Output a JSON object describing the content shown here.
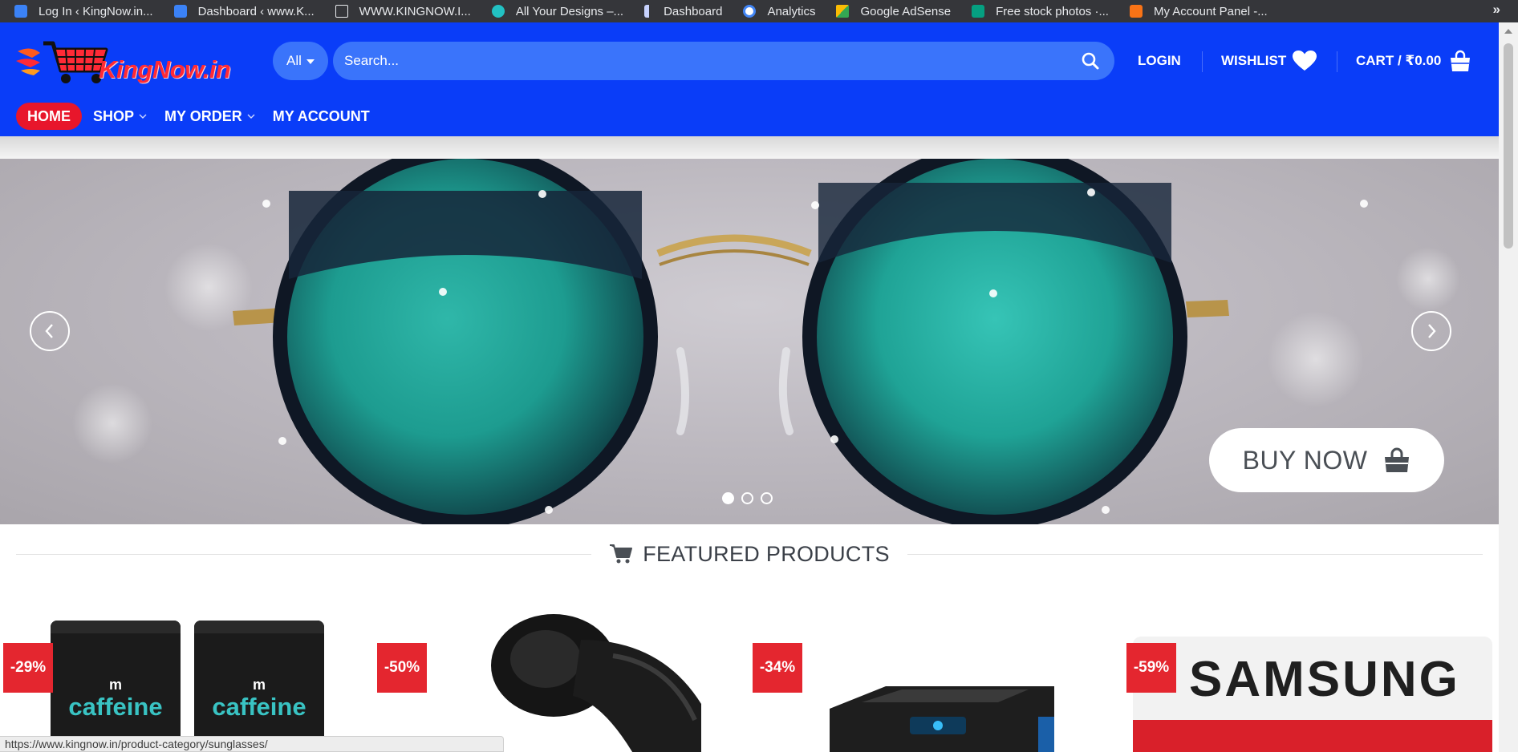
{
  "bookmarks": {
    "items": [
      {
        "label": "Log In ‹ KingNow.in...",
        "icon": "wordpress-icon",
        "color": "#3b82f6"
      },
      {
        "label": "Dashboard ‹ www.K...",
        "icon": "wordpress-icon",
        "color": "#3b82f6"
      },
      {
        "label": "WWW.KINGNOW.I...",
        "icon": "document-icon",
        "color": "#35363a"
      },
      {
        "label": "All Your Designs –...",
        "icon": "canva-icon",
        "color": "#22c1c3"
      },
      {
        "label": "Dashboard",
        "icon": "dashboard-icon",
        "color": "#c7d2fe"
      },
      {
        "label": "Analytics",
        "icon": "google-icon",
        "color": "#ffffff"
      },
      {
        "label": "Google AdSense",
        "icon": "adsense-icon",
        "color": "#fbbc04"
      },
      {
        "label": "Free stock photos ·...",
        "icon": "pexels-icon",
        "color": "#05a081"
      },
      {
        "label": "My Account Panel -...",
        "icon": "account-panel-icon",
        "color": "#f97316"
      }
    ],
    "more": "»"
  },
  "header": {
    "logo_text": "KingNow.in",
    "search": {
      "category": "All",
      "placeholder": "Search..."
    },
    "login": "LOGIN",
    "wishlist": "WISHLIST",
    "cart": "CART / ₹0.00",
    "nav": [
      {
        "label": "HOME",
        "active": true
      },
      {
        "label": "SHOP",
        "dropdown": true
      },
      {
        "label": "MY ORDER",
        "dropdown": true
      },
      {
        "label": "MY ACCOUNT"
      }
    ]
  },
  "hero": {
    "buy_label": "BUY NOW",
    "slides": 3,
    "active_slide": 1
  },
  "featured": {
    "title": "FEATURED PRODUCTS"
  },
  "products": [
    {
      "badge": "-29%",
      "brand": "caffeine",
      "brand_prefix": "m"
    },
    {
      "badge": "-50%"
    },
    {
      "badge": "-34%"
    },
    {
      "badge": "-59%",
      "brand": "SAMSUNG"
    }
  ],
  "status_url": "https://www.kingnow.in/product-category/sunglasses/",
  "colors": {
    "header_bg": "#0a3df8",
    "home_pill": "#e8162b",
    "badge": "#e4262f"
  }
}
